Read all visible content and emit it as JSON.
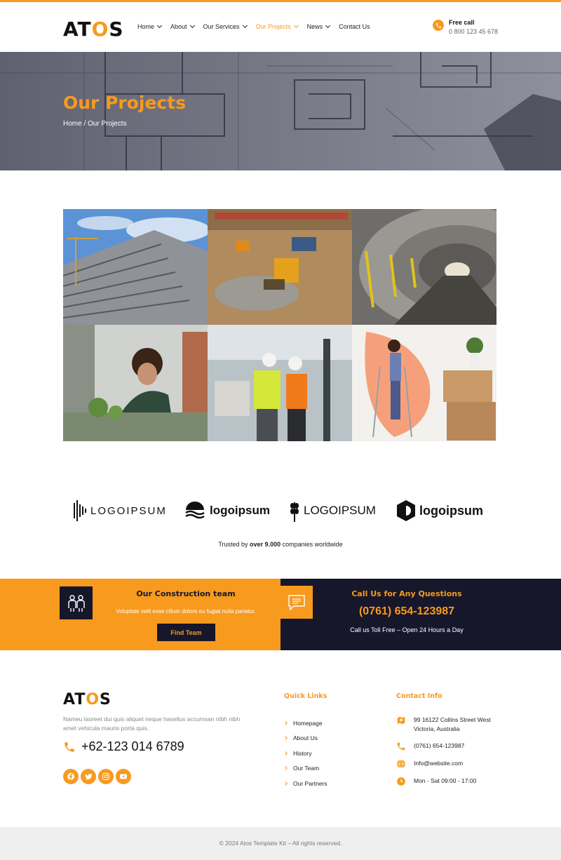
{
  "header": {
    "logo": {
      "pre": "AT",
      "o": "O",
      "post": "S"
    },
    "nav": [
      {
        "label": "Home",
        "dropdown": true
      },
      {
        "label": "About",
        "dropdown": true
      },
      {
        "label": "Our Services",
        "dropdown": true
      },
      {
        "label": "Our Projects",
        "dropdown": true,
        "active": true
      },
      {
        "label": "News",
        "dropdown": true
      },
      {
        "label": "Contact Us",
        "dropdown": false
      }
    ],
    "call_title": "Free call",
    "call_number": "0 800 123 45 678"
  },
  "hero": {
    "title": "Our Projects",
    "breadcrumb": "Home / Our Projects"
  },
  "gallery": {
    "tiles": [
      {
        "name": "building-construction-image"
      },
      {
        "name": "excavation-site-image"
      },
      {
        "name": "tunnel-image"
      },
      {
        "name": "architect-model-image"
      },
      {
        "name": "engineers-site-image"
      },
      {
        "name": "painting-wall-image"
      }
    ]
  },
  "partners": {
    "logos": [
      "LOGOIPSUM",
      "logoipsum",
      "LOGOIPSUM",
      "logoipsum"
    ],
    "trusted_pre": "Trusted by",
    "trusted_bold": "over 9.000",
    "trusted_post": "companies worldwide"
  },
  "cta": {
    "team_title": "Our Construction team",
    "team_sub": "Voluptate velit esse cillum dolore eu fugiat nulla pariatur.",
    "team_button": "Find Team",
    "call_title": "Call Us for Any Questions",
    "call_number": "(0761) 654-123987",
    "call_sub": "Call us Toll Free – Open 24 Hours a Day"
  },
  "footer": {
    "logo": {
      "pre": "AT",
      "o": "O",
      "post": "S"
    },
    "description": "Nameu laoreet dui quis aliquet neque hasellus accumsan nibh nibh amet vehicula mauris porta quis.",
    "phone": "+62-123 014 6789",
    "social": [
      "facebook-icon",
      "twitter-icon",
      "instagram-icon",
      "youtube-icon"
    ],
    "quick_links_title": "Quick Links",
    "quick_links": [
      "Homepage",
      "About Us",
      "History",
      "Our Team",
      "Our Partners"
    ],
    "contact_title": "Contact Info",
    "contact": [
      {
        "icon": "map-icon",
        "text": "99 16122 Collins Street West Victoria, Australia"
      },
      {
        "icon": "phone-icon",
        "text": "(0761) 654-123987"
      },
      {
        "icon": "globe-icon",
        "text": "Info@website.com"
      },
      {
        "icon": "clock-icon",
        "text": "Mon - Sat 09:00 - 17:00"
      }
    ],
    "copyright": "© 2024 Atos Template Kit – All rights reserved."
  },
  "colors": {
    "accent": "#f79a1e",
    "dark": "#17172b"
  }
}
